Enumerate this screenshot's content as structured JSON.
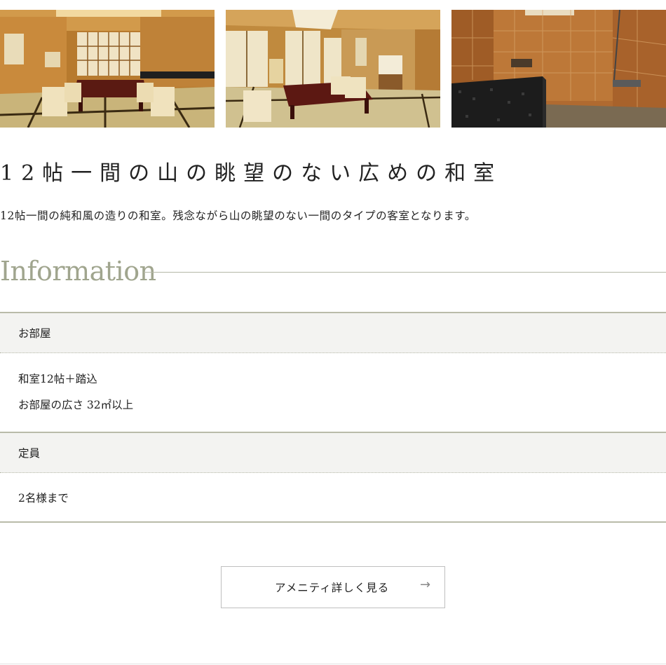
{
  "photos": [
    {
      "icon": "tatami-room-photo-1",
      "alt": ""
    },
    {
      "icon": "tatami-room-photo-2",
      "alt": ""
    },
    {
      "icon": "bathroom-photo",
      "alt": ""
    }
  ],
  "room": {
    "title": "12帖一間の山の眺望のない広めの和室",
    "description": "12帖一間の純和風の造りの和室。残念ながら山の眺望のない一間のタイプの客室となります。"
  },
  "information": {
    "heading": "Information",
    "sections": [
      {
        "label": "お部屋",
        "lines": [
          "和室12帖＋踏込",
          "お部屋の広さ 32㎡以上"
        ]
      },
      {
        "label": "定員",
        "lines": [
          "2名様まで"
        ]
      }
    ]
  },
  "amenity_button": {
    "label": "アメニティ詳しく見る",
    "arrow": "→"
  },
  "colors": {
    "heading_accent": "#a0a58e",
    "rule": "#b9bba9",
    "table_head_bg": "#f3f3f1"
  }
}
